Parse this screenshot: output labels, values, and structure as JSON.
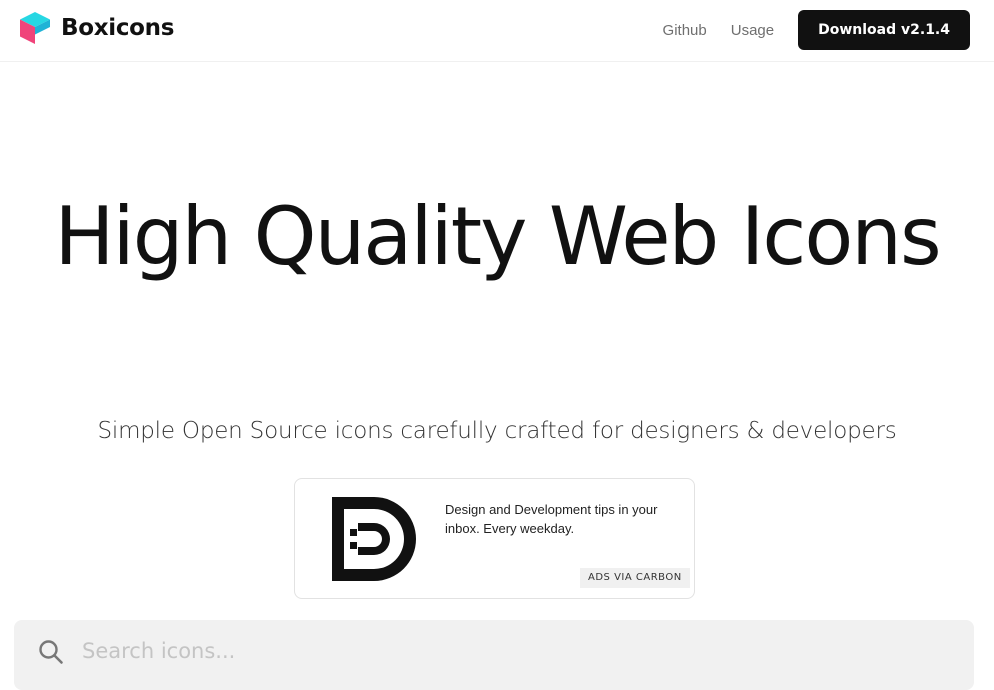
{
  "header": {
    "brand": "Boxicons",
    "nav": [
      {
        "label": "Github"
      },
      {
        "label": "Usage"
      }
    ],
    "download_label": "Download v2.1.4"
  },
  "hero": {
    "title": "High Quality Web Icons",
    "subtitle": "Simple Open Source icons carefully crafted for designers & developers"
  },
  "ad": {
    "text": "Design and Development tips in your inbox. Every weekday.",
    "badge": "ADS VIA CARBON"
  },
  "search": {
    "placeholder": "Search icons..."
  },
  "colors": {
    "primary_text": "#111111",
    "nav_text": "#6f6f6f",
    "logo_cyan": "#27d7e3",
    "logo_pink": "#f0447a",
    "search_bg": "#f1f1f1"
  },
  "icons": {
    "logo": "boxicons-logo-icon",
    "ad_logo": "dd-logo-icon",
    "search": "search-icon"
  }
}
